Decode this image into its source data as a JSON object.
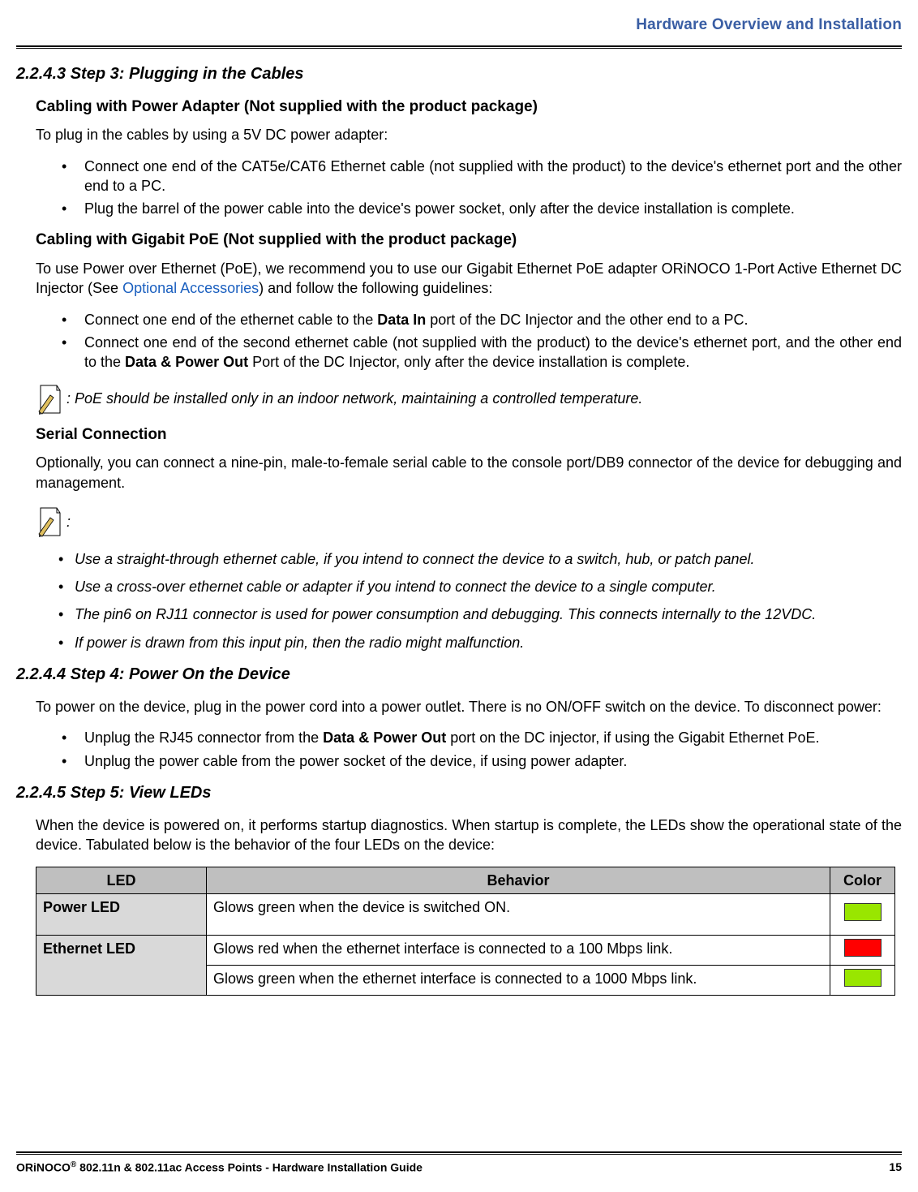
{
  "header": {
    "running_title": "Hardware Overview and Installation"
  },
  "step3": {
    "heading": "2.2.4.3 Step 3: Plugging in the Cables",
    "pa": {
      "title": "Cabling with Power Adapter (Not supplied with the product package)",
      "intro": "To plug in the cables by using a 5V DC power adapter:",
      "b1": "Connect one end of the CAT5e/CAT6 Ethernet cable (not supplied with the product) to the device's ethernet port and the other end to a PC.",
      "b2": "Plug the barrel of the power cable into the device's power socket, only after the device installation is complete."
    },
    "poe": {
      "title": "Cabling with Gigabit PoE (Not supplied with the product package)",
      "intro_pre": "To use Power over Ethernet (PoE), we recommend you to use our Gigabit Ethernet PoE adapter ORiNOCO 1-Port Active Ethernet DC Injector (See ",
      "intro_link": "Optional Accessories",
      "intro_post": ") and follow the following guidelines:",
      "b1_pre": "Connect one end of the ethernet cable to the ",
      "b1_bold": "Data In",
      "b1_post": " port of the DC Injector and the other end to a PC.",
      "b2_pre": "Connect one end of the second ethernet cable (not supplied with the product) to the device's ethernet port, and the other end to the ",
      "b2_bold": "Data & Power Out",
      "b2_post": " Port of the DC Injector, only after the device installation is complete.",
      "note": ": PoE should be installed only in an indoor network, maintaining a controlled temperature."
    },
    "serial": {
      "title": "Serial Connection",
      "para": "Optionally, you can connect a nine-pin, male-to-female serial cable to the console port/DB9 connector of the device for debugging and management.",
      "note_colon": ":",
      "n1": "Use a straight-through ethernet cable, if you intend to connect the device to a switch, hub, or patch panel.",
      "n2": "Use a cross-over ethernet cable or adapter if you intend to connect the device to a single computer.",
      "n3": "The pin6 on RJ11 connector is used for power consumption and debugging. This connects internally to the 12VDC.",
      "n4": "If power is drawn from this input pin, then the radio might malfunction."
    }
  },
  "step4": {
    "heading": "2.2.4.4 Step 4: Power On the Device",
    "para": "To power on the device, plug in the power cord into a power outlet. There is no ON/OFF switch on the device. To disconnect power:",
    "b1_pre": "Unplug the RJ45 connector from the ",
    "b1_bold": "Data & Power Out",
    "b1_post": " port on the DC injector, if using the Gigabit Ethernet PoE.",
    "b2": "Unplug the power cable from the power socket of the device, if using power adapter."
  },
  "step5": {
    "heading": "2.2.4.5 Step 5: View LEDs",
    "para": "When the device is powered on, it performs startup diagnostics. When startup is complete, the LEDs show the operational state of the device. Tabulated below is the behavior of the four LEDs on the device:",
    "table": {
      "h1": "LED",
      "h2": "Behavior",
      "h3": "Color",
      "r1_led": "Power LED",
      "r1_behavior": "Glows green when the device is switched ON.",
      "r1_color": "#99e600",
      "r2_led": "Ethernet LED",
      "r2_behavior": "Glows red when the ethernet interface is connected to a 100 Mbps link.",
      "r2_color": "#ff0000",
      "r3_behavior": "Glows green when the ethernet interface is connected to a 1000 Mbps link.",
      "r3_color": "#99e600"
    }
  },
  "footer": {
    "left_pre": "ORiNOCO",
    "left_sup": "®",
    "left_post": " 802.11n & 802.11ac Access Points - Hardware Installation Guide",
    "page_no": "15"
  },
  "chart_data": {
    "type": "table",
    "title": "LED Behavior",
    "columns": [
      "LED",
      "Behavior",
      "Color"
    ],
    "rows": [
      {
        "LED": "Power LED",
        "Behavior": "Glows green when the device is switched ON.",
        "Color": "green"
      },
      {
        "LED": "Ethernet LED",
        "Behavior": "Glows red when the ethernet interface is connected to a 100 Mbps link.",
        "Color": "red"
      },
      {
        "LED": "Ethernet LED",
        "Behavior": "Glows green when the ethernet interface is connected to a 1000 Mbps link.",
        "Color": "green"
      }
    ]
  }
}
